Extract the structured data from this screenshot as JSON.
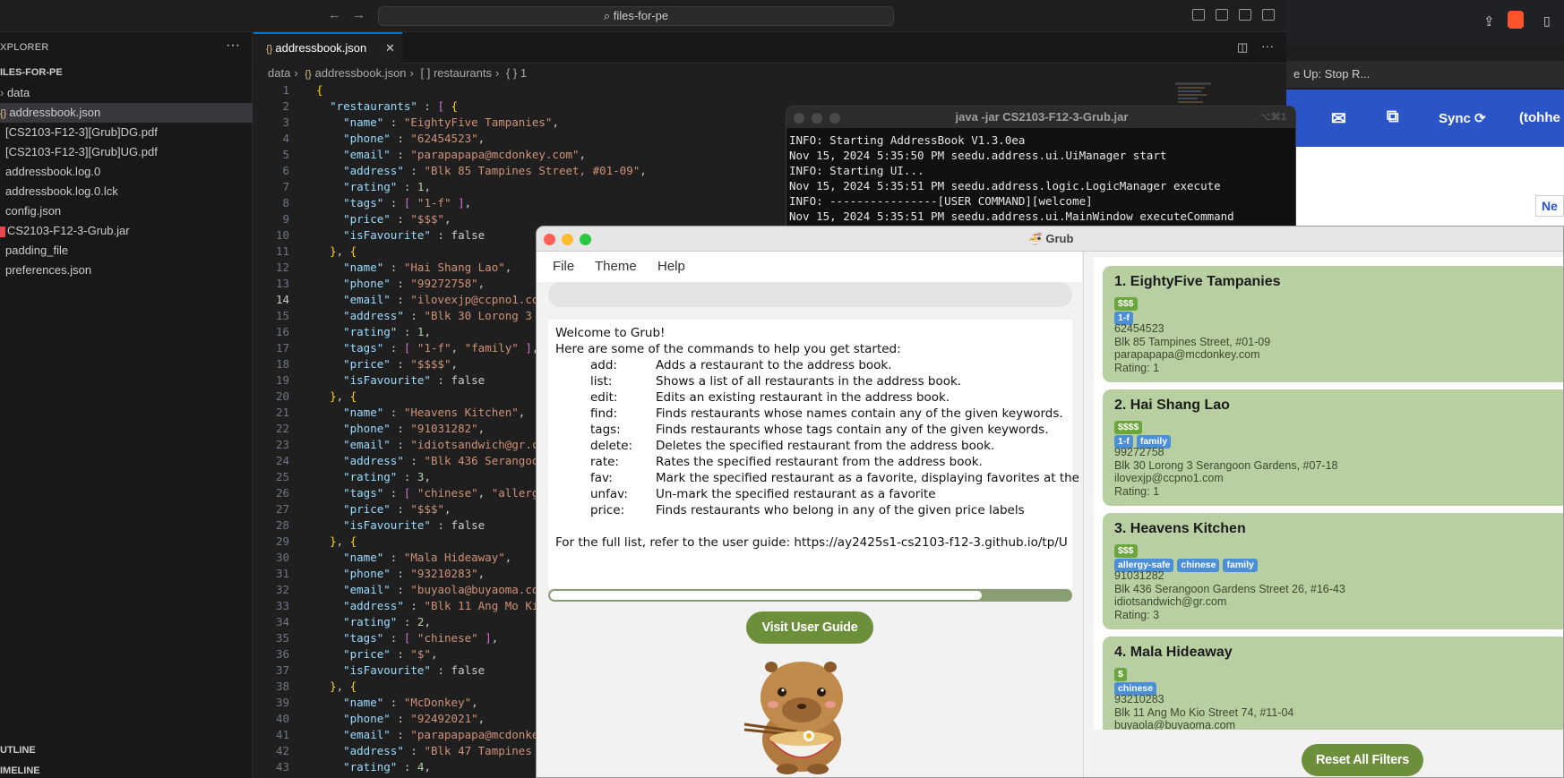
{
  "vscode": {
    "search_text": "files-for-pe",
    "explorer_title": "XPLORER",
    "root_folder": "ILES-FOR-PE",
    "files": [
      {
        "label": "data"
      },
      {
        "label": "addressbook.json"
      },
      {
        "label": "[CS2103-F12-3][Grub]DG.pdf"
      },
      {
        "label": "[CS2103-F12-3][Grub]UG.pdf"
      },
      {
        "label": "addressbook.log.0"
      },
      {
        "label": "addressbook.log.0.lck"
      },
      {
        "label": "config.json"
      },
      {
        "label": "CS2103-F12-3-Grub.jar"
      },
      {
        "label": "padding_file"
      },
      {
        "label": "preferences.json"
      }
    ],
    "outline_label": "UTLINE",
    "timeline_label": "IMELINE",
    "tab_label": "addressbook.json",
    "breadcrumb": [
      "data",
      "addressbook.json",
      "[ ] restaurants",
      "{ } 1"
    ],
    "code_lines": [
      {
        "n": "1",
        "t": "{"
      },
      {
        "n": "2",
        "t": "  \"restaurants\" : [ {"
      },
      {
        "n": "3",
        "t": "    \"name\" : \"EightyFive Tampanies\","
      },
      {
        "n": "4",
        "t": "    \"phone\" : \"62454523\","
      },
      {
        "n": "5",
        "t": "    \"email\" : \"parapapapa@mcdonkey.com\","
      },
      {
        "n": "6",
        "t": "    \"address\" : \"Blk 85 Tampines Street, #01-09\","
      },
      {
        "n": "7",
        "t": "    \"rating\" : 1,"
      },
      {
        "n": "8",
        "t": "    \"tags\" : [ \"1-f\" ],"
      },
      {
        "n": "9",
        "t": "    \"price\" : \"$$$\","
      },
      {
        "n": "10",
        "t": "    \"isFavourite\" : false"
      },
      {
        "n": "11",
        "t": "  }, {"
      },
      {
        "n": "12",
        "t": "    \"name\" : \"Hai Shang Lao\","
      },
      {
        "n": "13",
        "t": "    \"phone\" : \"99272758\","
      },
      {
        "n": "14",
        "t": "    \"email\" : \"ilovexjp@ccpno1.com\","
      },
      {
        "n": "15",
        "t": "    \"address\" : \"Blk 30 Lorong 3 Se"
      },
      {
        "n": "16",
        "t": "    \"rating\" : 1,"
      },
      {
        "n": "17",
        "t": "    \"tags\" : [ \"1-f\", \"family\" ],"
      },
      {
        "n": "18",
        "t": "    \"price\" : \"$$$$\","
      },
      {
        "n": "19",
        "t": "    \"isFavourite\" : false"
      },
      {
        "n": "20",
        "t": "  }, {"
      },
      {
        "n": "21",
        "t": "    \"name\" : \"Heavens Kitchen\","
      },
      {
        "n": "22",
        "t": "    \"phone\" : \"91031282\","
      },
      {
        "n": "23",
        "t": "    \"email\" : \"idiotsandwich@gr.com"
      },
      {
        "n": "24",
        "t": "    \"address\" : \"Blk 436 Serangoon"
      },
      {
        "n": "25",
        "t": "    \"rating\" : 3,"
      },
      {
        "n": "26",
        "t": "    \"tags\" : [ \"chinese\", \"allergy-"
      },
      {
        "n": "27",
        "t": "    \"price\" : \"$$$\","
      },
      {
        "n": "28",
        "t": "    \"isFavourite\" : false"
      },
      {
        "n": "29",
        "t": "  }, {"
      },
      {
        "n": "30",
        "t": "    \"name\" : \"Mala Hideaway\","
      },
      {
        "n": "31",
        "t": "    \"phone\" : \"93210283\","
      },
      {
        "n": "32",
        "t": "    \"email\" : \"buyaola@buyaoma.com\""
      },
      {
        "n": "33",
        "t": "    \"address\" : \"Blk 11 Ang Mo Kio"
      },
      {
        "n": "34",
        "t": "    \"rating\" : 2,"
      },
      {
        "n": "35",
        "t": "    \"tags\" : [ \"chinese\" ],"
      },
      {
        "n": "36",
        "t": "    \"price\" : \"$\","
      },
      {
        "n": "37",
        "t": "    \"isFavourite\" : false"
      },
      {
        "n": "38",
        "t": "  }, {"
      },
      {
        "n": "39",
        "t": "    \"name\" : \"McDonkey\","
      },
      {
        "n": "40",
        "t": "    \"phone\" : \"92492021\","
      },
      {
        "n": "41",
        "t": "    \"email\" : \"parapapapa@mcdonkey"
      },
      {
        "n": "42",
        "t": "    \"address\" : \"Blk 47 Tampines St"
      },
      {
        "n": "43",
        "t": "    \"rating\" : 4,"
      }
    ]
  },
  "browser": {
    "tab_title": "e Up: Stop R...",
    "sync_label": "Sync",
    "user_label": "(tohhe",
    "page_button": "Ne"
  },
  "terminal": {
    "title": "java -jar CS2103-F12-3-Grub.jar",
    "shortcut": "⌥⌘1",
    "lines": [
      "INFO: Starting AddressBook V1.3.0ea",
      "Nov 15, 2024 5:35:50 PM seedu.address.ui.UiManager start",
      "INFO: Starting UI...",
      "Nov 15, 2024 5:35:51 PM seedu.address.logic.LogicManager execute",
      "INFO: ----------------[USER COMMAND][welcome]",
      "Nov 15, 2024 5:35:51 PM seedu.address.ui.MainWindow executeCommand"
    ]
  },
  "grub": {
    "title": "Grub",
    "menu": [
      "File",
      "Theme",
      "Help"
    ],
    "welcome": "Welcome to Grub!",
    "intro": "Here are some of the commands to help you get started:",
    "commands": [
      {
        "cmd": "add:",
        "desc": "Adds a restaurant to the address book."
      },
      {
        "cmd": "list:",
        "desc": "Shows a list of all restaurants in the address book."
      },
      {
        "cmd": "edit:",
        "desc": "Edits an existing restaurant in the address book."
      },
      {
        "cmd": "find:",
        "desc": "Finds restaurants whose names contain any of the given keywords."
      },
      {
        "cmd": "tags:",
        "desc": "Finds restaurants whose tags contain any of the given keywords."
      },
      {
        "cmd": "delete:",
        "desc": "Deletes the specified restaurant from the address book."
      },
      {
        "cmd": "rate:",
        "desc": "Rates the specified restaurant from the address book."
      },
      {
        "cmd": "fav:",
        "desc": "Mark the specified restaurant as a favorite, displaying favorites at the"
      },
      {
        "cmd": "unfav:",
        "desc": "Un-mark the specified restaurant as a favorite"
      },
      {
        "cmd": "price:",
        "desc": "Finds restaurants who belong in any of the given price labels"
      }
    ],
    "footer": "For the full list, refer to the user guide: https://ay2425s1-cs2103-f12-3.github.io/tp/U",
    "scroll_fraction": 0.83,
    "guide_button": "Visit User Guide",
    "reset_button": "Reset All Filters",
    "restaurants": [
      {
        "title": "1. EightyFive Tampanies",
        "price": "$$$",
        "tags": [
          "1-f"
        ],
        "phone": "62454523",
        "address": "Blk 85 Tampines Street, #01-09",
        "email": "parapapapa@mcdonkey.com",
        "rating": "Rating:  1"
      },
      {
        "title": "2. Hai Shang Lao",
        "price": "$$$$",
        "tags": [
          "1-f",
          "family"
        ],
        "phone": "99272758",
        "address": "Blk 30 Lorong 3 Serangoon Gardens, #07-18",
        "email": "ilovexjp@ccpno1.com",
        "rating": "Rating:  1"
      },
      {
        "title": "3. Heavens Kitchen",
        "price": "$$$",
        "tags": [
          "allergy-safe",
          "chinese",
          "family"
        ],
        "phone": "91031282",
        "address": "Blk 436 Serangoon Gardens Street 26, #16-43",
        "email": "idiotsandwich@gr.com",
        "rating": "Rating:  3"
      },
      {
        "title": "4. Mala Hideaway",
        "price": "$",
        "tags": [
          "chinese"
        ],
        "phone": "93210283",
        "address": "Blk 11 Ang Mo Kio Street 74, #11-04",
        "email": "buyaola@buyaoma.com",
        "rating": ""
      }
    ]
  }
}
